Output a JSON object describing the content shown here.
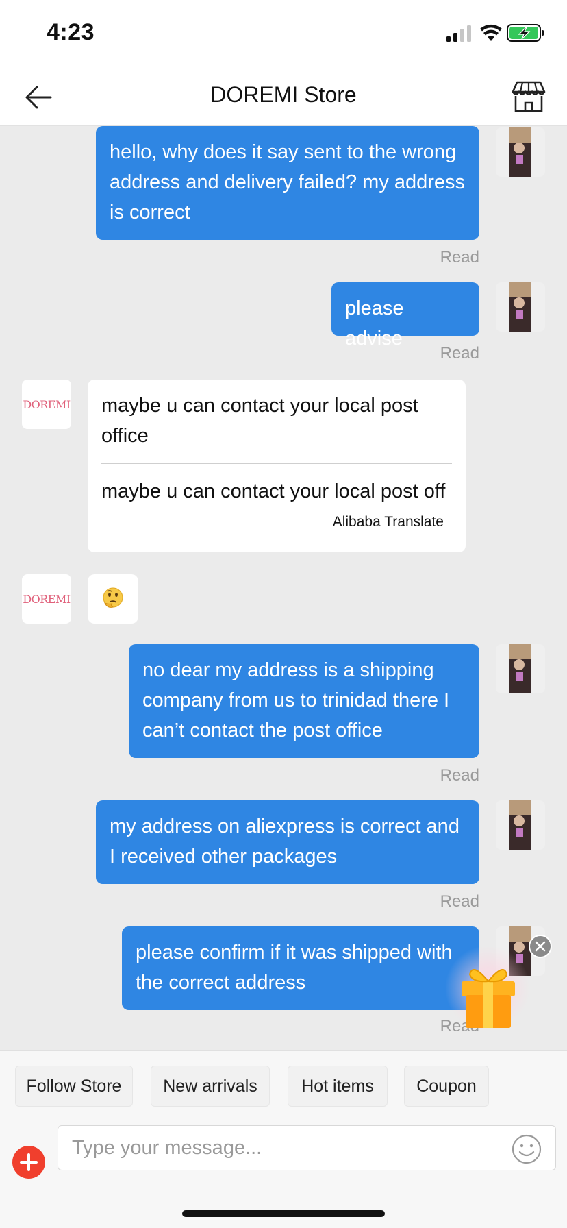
{
  "status_bar": {
    "time": "4:23"
  },
  "nav": {
    "title": "DOREMI Store"
  },
  "store_logo_text": "DOREMI",
  "messages": [
    {
      "text": "hello, why does it say sent to the wrong address and delivery failed? my address is correct",
      "status": "Read"
    },
    {
      "text": "please advise",
      "status": "Read"
    },
    {
      "text": "maybe u can contact your local post office",
      "translation": "maybe u can contact your local post off",
      "translator": "Alibaba Translate"
    },
    {
      "emoji": "thinking-face"
    },
    {
      "text": "no dear my address is a shipping company from us to trinidad there I can’t contact the post office",
      "status": "Read"
    },
    {
      "text": "my address on aliexpress is correct and I received other packages",
      "status": "Read"
    },
    {
      "text": "please confirm if it was shipped with the correct address",
      "status": "Read"
    }
  ],
  "quick_replies": [
    "Follow Store",
    "New arrivals",
    "Hot items",
    "Coupon"
  ],
  "input": {
    "placeholder": "Type your message..."
  },
  "colors": {
    "outgoing_bubble": "#2f86e3",
    "incoming_bubble": "#ffffff",
    "background": "#ebebeb",
    "plus_button": "#f03f2d"
  }
}
